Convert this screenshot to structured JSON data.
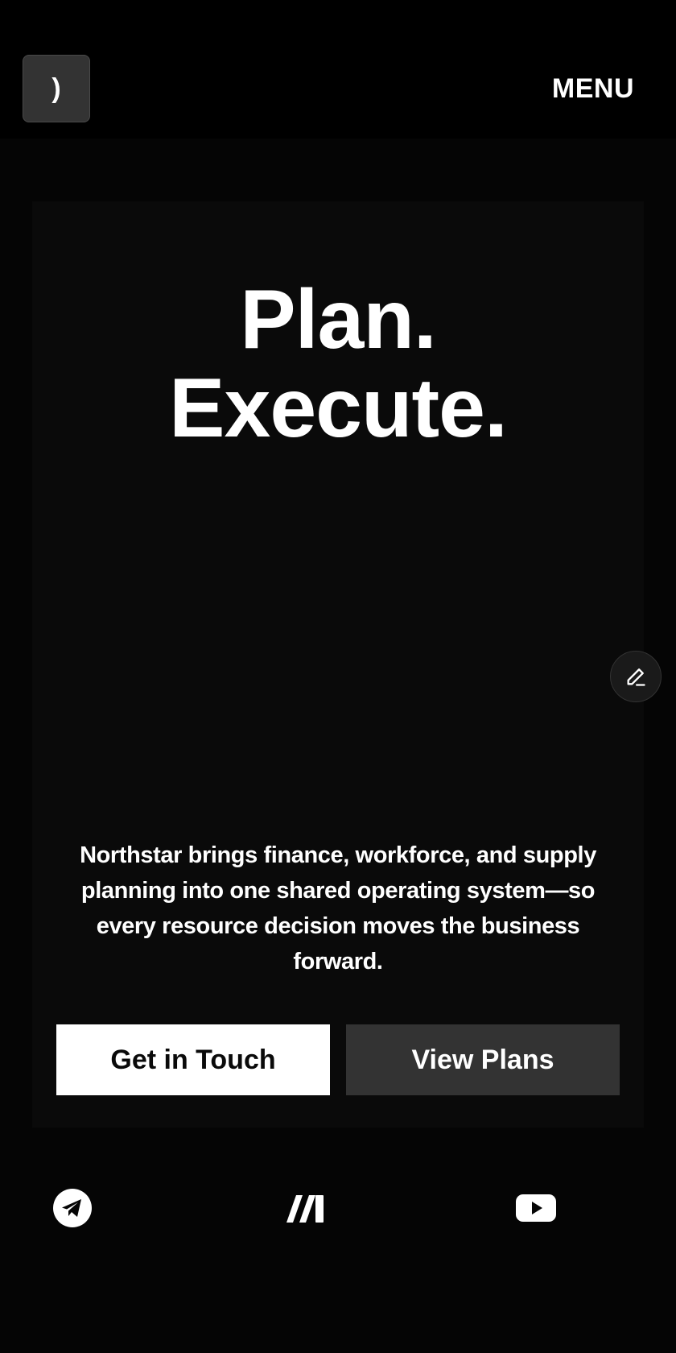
{
  "header": {
    "logo_glyph": ")",
    "menu_label": "MENU"
  },
  "hero": {
    "title_line1": "Plan.",
    "title_line2": "Execute.",
    "description": "Northstar brings finance, workforce, and supply planning into one shared operating system—so every resource decision moves the business forward.",
    "primary_cta": "Get in Touch",
    "secondary_cta": "View Plans"
  },
  "floating": {
    "edit_icon": "pencil-icon"
  },
  "social": {
    "icons": [
      "telegram-icon",
      "make-icon",
      "youtube-icon"
    ]
  },
  "colors": {
    "background": "#050505",
    "header": "#000000",
    "panel": "#0a0a0a",
    "primary_button": "#ffffff",
    "secondary_button": "#333333",
    "text": "#ffffff"
  }
}
